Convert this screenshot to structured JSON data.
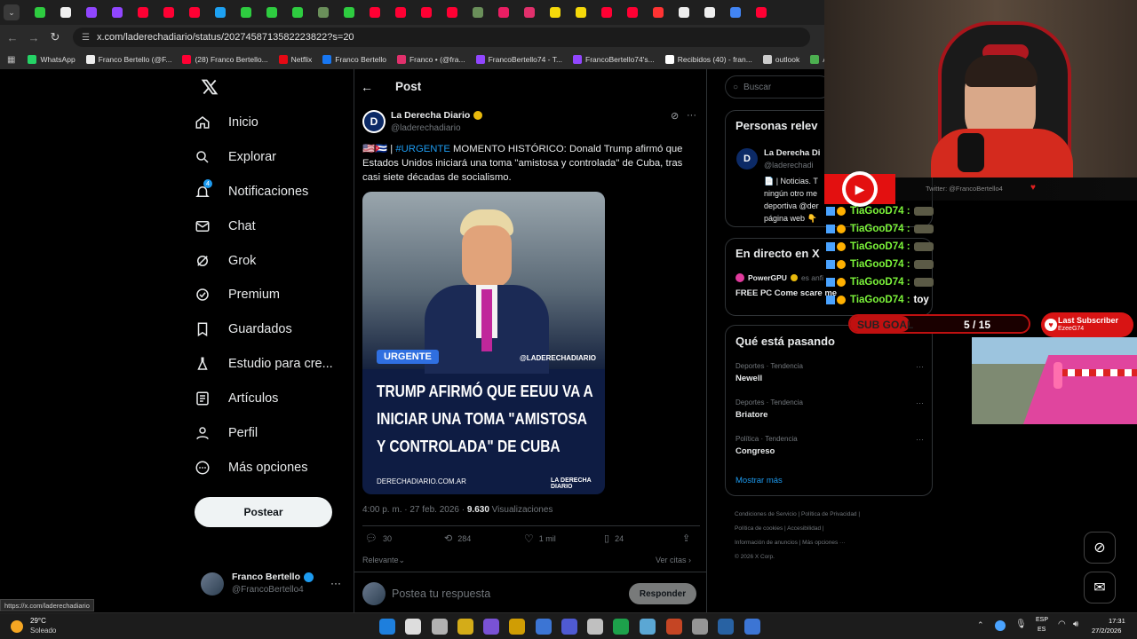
{
  "browser": {
    "url": "x.com/laderechadiario/status/2027458713582223822?s=20",
    "tab_colors": [
      "#2ecc40",
      "#f0f0f0",
      "#9146ff",
      "#9146ff",
      "#ff0033",
      "#ff0033",
      "#ff0033",
      "#1da1f2",
      "#2ecc40",
      "#2ecc40",
      "#2ecc40",
      "#6a8f5a",
      "#2ecc40",
      "#ff0033",
      "#ff0033",
      "#ff0033",
      "#ff0033",
      "#6a8f5a",
      "#e91e63",
      "#e1306c",
      "#f5d90a",
      "#f5d90a",
      "#ff0033",
      "#ff0033",
      "#ff3333",
      "#eeeeee",
      "#eeeeee",
      "#4285f4",
      "#ff0033"
    ],
    "bookmarks": [
      {
        "label": "WhatsApp",
        "color": "#25d366"
      },
      {
        "label": "Franco Bertello (@F...",
        "color": "#eeeeee"
      },
      {
        "label": "(28) Franco Bertello...",
        "color": "#ff0033"
      },
      {
        "label": "Netflix",
        "color": "#e50914"
      },
      {
        "label": "Franco Bertello",
        "color": "#1877f2"
      },
      {
        "label": "Franco • (@fra...",
        "color": "#e1306c"
      },
      {
        "label": "FrancoBertello74 - T...",
        "color": "#9146ff"
      },
      {
        "label": "FrancoBertello74's...",
        "color": "#9146ff"
      },
      {
        "label": "Recibidos (40) - fran...",
        "color": "#ffffff"
      },
      {
        "label": "outlook",
        "color": "#cccccc"
      },
      {
        "label": "Aler",
        "color": "#4caf50"
      }
    ]
  },
  "sidebar": {
    "items": [
      {
        "label": "Inicio",
        "icon": "home-icon"
      },
      {
        "label": "Explorar",
        "icon": "search-icon"
      },
      {
        "label": "Notificaciones",
        "icon": "bell-icon",
        "badge": "4"
      },
      {
        "label": "Chat",
        "icon": "mail-icon"
      },
      {
        "label": "Grok",
        "icon": "grok-icon"
      },
      {
        "label": "Premium",
        "icon": "verified-icon"
      },
      {
        "label": "Guardados",
        "icon": "bookmark-icon"
      },
      {
        "label": "Estudio para cre...",
        "icon": "flask-icon"
      },
      {
        "label": "Artículos",
        "icon": "article-icon"
      },
      {
        "label": "Perfil",
        "icon": "person-icon"
      },
      {
        "label": "Más opciones",
        "icon": "more-circle-icon"
      }
    ],
    "post_button": "Postear",
    "account": {
      "name": "Franco Bertello",
      "handle": "@FrancoBertello4"
    }
  },
  "post": {
    "header": "Post",
    "author": "La Derecha Diario",
    "handle": "@laderechadiario",
    "text_prefix": "🇺🇸🇨🇺 | ",
    "hashtag": "#URGENTE",
    "text": " MOMENTO HISTÓRICO: Donald Trump afirmó que Estados Unidos iniciará una toma \"amistosa y controlada\" de Cuba, tras casi siete décadas de socialismo.",
    "image": {
      "tag": "URGENTE",
      "handle_mark": "@LADERECHADIARIO",
      "headline": [
        "TRUMP AFIRMÓ QUE EEUU VA A",
        "INICIAR UNA TOMA \"AMISTOSA",
        "Y CONTROLADA\" DE CUBA"
      ],
      "site": "DERECHADIARIO.COM.AR",
      "logo": "LA DERECHA DIARIO"
    },
    "time": "4:00 p. m. · 27 feb. 2026 · ",
    "views": "9.630",
    "views_label": " Visualizaciones",
    "replies": "30",
    "reposts": "284",
    "likes": "1 mil",
    "bookmarks": "24",
    "sort": "Relevante",
    "see_quotes": "Ver citas",
    "reply_placeholder": "Postea tu respuesta",
    "reply_button": "Responder"
  },
  "right": {
    "search_placeholder": "Buscar",
    "relevant_title": "Personas relev",
    "relevant_name": "La Derecha Di",
    "relevant_handle": "@laderechadi",
    "relevant_bio": [
      "📄 | Noticias. T",
      "ningún otro me",
      "deportiva @der",
      "página web 👇"
    ],
    "live_title": "En directo en X",
    "live_user": "PowerGPU",
    "live_suffix": "es anfi",
    "live_text": "FREE PC Come scare me",
    "trending_title": "Qué está pasando",
    "trends": [
      {
        "cat": "Deportes · Tendencia",
        "name": "Newell"
      },
      {
        "cat": "Deportes · Tendencia",
        "name": "Briatore"
      },
      {
        "cat": "Política · Tendencia",
        "name": "Congreso"
      }
    ],
    "show_more": "Mostrar más",
    "footer": [
      "Condiciones de Servicio",
      "Política de Privacidad",
      "Política de cookies",
      "Accesibilidad",
      "Información de anuncios",
      "Más opciones ···",
      "© 2026 X Corp."
    ]
  },
  "overlay": {
    "twitter_handle": "Twitter: @FrancoBertello4",
    "chat_user": "TiaGooD74 :",
    "chat_last": "toy",
    "sub_goal_label": "SUB GOAL",
    "sub_goal_value": "5 / 15",
    "sub_goal_progress": 0.3333,
    "last_sub_label": "Last Subscriber",
    "last_sub_name": "EzeeG74"
  },
  "status_url": "https://x.com/laderechadiario",
  "taskbar": {
    "weather_temp": "29°C",
    "weather_desc": "Soleado",
    "lang1": "ESP",
    "lang2": "ES",
    "time": "17:31",
    "date": "27/2/2026",
    "app_colors": [
      "#1e90ff",
      "#ffffff",
      "#cccccc",
      "#f5c518",
      "#8a5cf6",
      "#f0b400",
      "#4285f4",
      "#5865f2",
      "#dddddd",
      "#1db954",
      "#66c0f4",
      "#e34c26",
      "#aaaaaa",
      "#2a6ebb",
      "#4285f4"
    ]
  }
}
